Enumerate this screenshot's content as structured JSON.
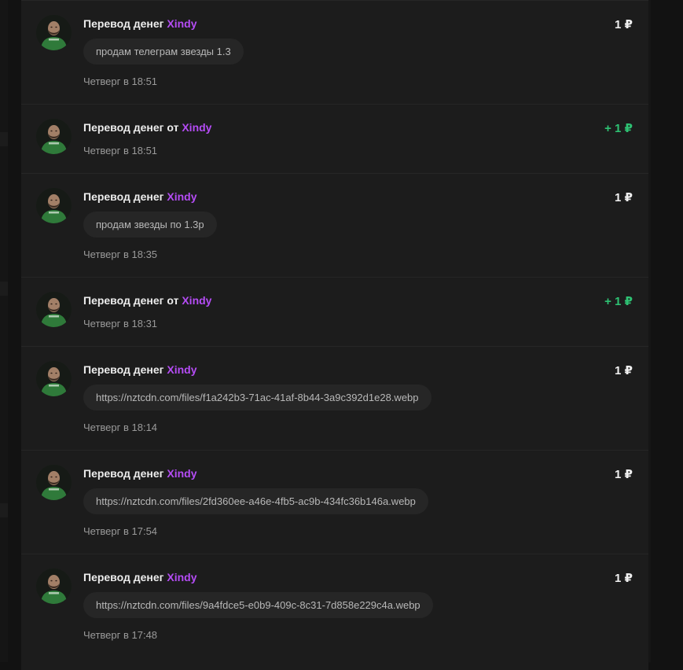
{
  "colors": {
    "background": "#121212",
    "card": "#1c1c1c",
    "bubble": "#262626",
    "username": "#b54cf5",
    "incoming_amount": "#2ec273",
    "text": "#ececec",
    "muted": "#9a9a9a"
  },
  "transactions": [
    {
      "prefix": "Перевод денег",
      "user": "Xindy",
      "amount": "1 ₽",
      "direction": "outgoing",
      "message": "продам телеграм звезды 1.3",
      "time": "Четверг в 18:51",
      "avatar": "user-avatar"
    },
    {
      "prefix": "Перевод денег от",
      "user": "Xindy",
      "amount": "+ 1 ₽",
      "direction": "incoming",
      "message": "",
      "time": "Четверг в 18:51",
      "avatar": "user-avatar"
    },
    {
      "prefix": "Перевод денег",
      "user": "Xindy",
      "amount": "1 ₽",
      "direction": "outgoing",
      "message": "продам звезды по 1.3р",
      "time": "Четверг в 18:35",
      "avatar": "user-avatar"
    },
    {
      "prefix": "Перевод денег от",
      "user": "Xindy",
      "amount": "+ 1 ₽",
      "direction": "incoming",
      "message": "",
      "time": "Четверг в 18:31",
      "avatar": "user-avatar"
    },
    {
      "prefix": "Перевод денег",
      "user": "Xindy",
      "amount": "1 ₽",
      "direction": "outgoing",
      "message": "https://nztcdn.com/files/f1a242b3-71ac-41af-8b44-3a9c392d1e28.webp",
      "time": "Четверг в 18:14",
      "avatar": "user-avatar"
    },
    {
      "prefix": "Перевод денег",
      "user": "Xindy",
      "amount": "1 ₽",
      "direction": "outgoing",
      "message": "https://nztcdn.com/files/2fd360ee-a46e-4fb5-ac9b-434fc36b146a.webp",
      "time": "Четверг в 17:54",
      "avatar": "user-avatar"
    },
    {
      "prefix": "Перевод денег",
      "user": "Xindy",
      "amount": "1 ₽",
      "direction": "outgoing",
      "message": "https://nztcdn.com/files/9a4fdce5-e0b9-409c-8c31-7d858e229c4a.webp",
      "time": "Четверг в 17:48",
      "avatar": "user-avatar"
    }
  ]
}
